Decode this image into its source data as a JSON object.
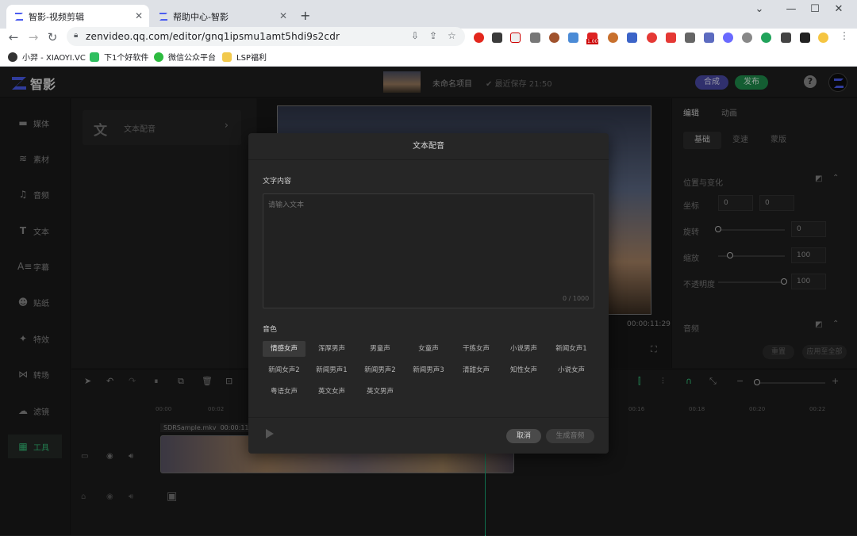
{
  "browser": {
    "tabs": [
      {
        "title": "智影-视频剪辑",
        "active": true
      },
      {
        "title": "帮助中心-智影",
        "active": false
      }
    ],
    "url": "zenvideo.qq.com/editor/gnq1ipsmu1amt5hdi9s2cdr",
    "extension_badge": "1.00",
    "bookmarks": [
      "小羿 - XIAOYI.VC",
      "下1个好软件",
      "微信公众平台",
      "LSP福利"
    ]
  },
  "app": {
    "brand": "智影",
    "project_name": "未命名项目",
    "save_status": "最近保存 21:50",
    "compose_label": "合成",
    "publish_label": "发布",
    "accent": "#35c07a"
  },
  "sidebar": {
    "items": [
      {
        "label": "媒体",
        "icon": "folder-icon"
      },
      {
        "label": "素材",
        "icon": "layers-icon"
      },
      {
        "label": "音频",
        "icon": "music-note-icon"
      },
      {
        "label": "文本",
        "icon": "text-t-icon"
      },
      {
        "label": "字幕",
        "icon": "subtitle-icon"
      },
      {
        "label": "贴纸",
        "icon": "sticker-icon"
      },
      {
        "label": "特效",
        "icon": "sparkle-icon"
      },
      {
        "label": "转场",
        "icon": "transition-icon"
      },
      {
        "label": "滤镜",
        "icon": "filter-icon"
      },
      {
        "label": "工具",
        "icon": "grid-icon",
        "selected": true
      }
    ]
  },
  "tools_panel": {
    "card_label": "文本配音",
    "card_icon": "文"
  },
  "preview": {
    "timecode": "00:00:11:29"
  },
  "properties": {
    "tabs": [
      "编辑",
      "动画"
    ],
    "subtabs": [
      "基础",
      "变速",
      "蒙版"
    ],
    "section_position": "位置与变化",
    "coord_label": "坐标",
    "coord_x": "0",
    "coord_y": "0",
    "rotate_label": "旋转",
    "rotate_value": "0",
    "scale_label": "缩放",
    "scale_value": "100",
    "opacity_label": "不透明度",
    "opacity_value": "100",
    "section_audio": "音频",
    "reset_label": "重置",
    "apply_all_label": "应用至全部"
  },
  "timeline": {
    "ruler": [
      "00:00",
      "00:02",
      "00:16",
      "00:18",
      "00:20",
      "00:22"
    ],
    "clip_name": "SDRSample.mkv",
    "clip_duration": "00:00:11"
  },
  "modal": {
    "title": "文本配音",
    "text_label": "文字内容",
    "text_placeholder": "请输入文本",
    "char_count": "0 / 1000",
    "timbre_label": "音色",
    "voices": [
      "情感女声",
      "浑厚男声",
      "男童声",
      "女童声",
      "干练女声",
      "小说男声",
      "新闻女声1",
      "新闻女声2",
      "新闻男声1",
      "新闻男声2",
      "新闻男声3",
      "清甜女声",
      "知性女声",
      "小说女声",
      "粤语女声",
      "英文女声",
      "英文男声"
    ],
    "selected_voice": "情感女声",
    "cancel_label": "取消",
    "generate_label": "生成音频"
  }
}
